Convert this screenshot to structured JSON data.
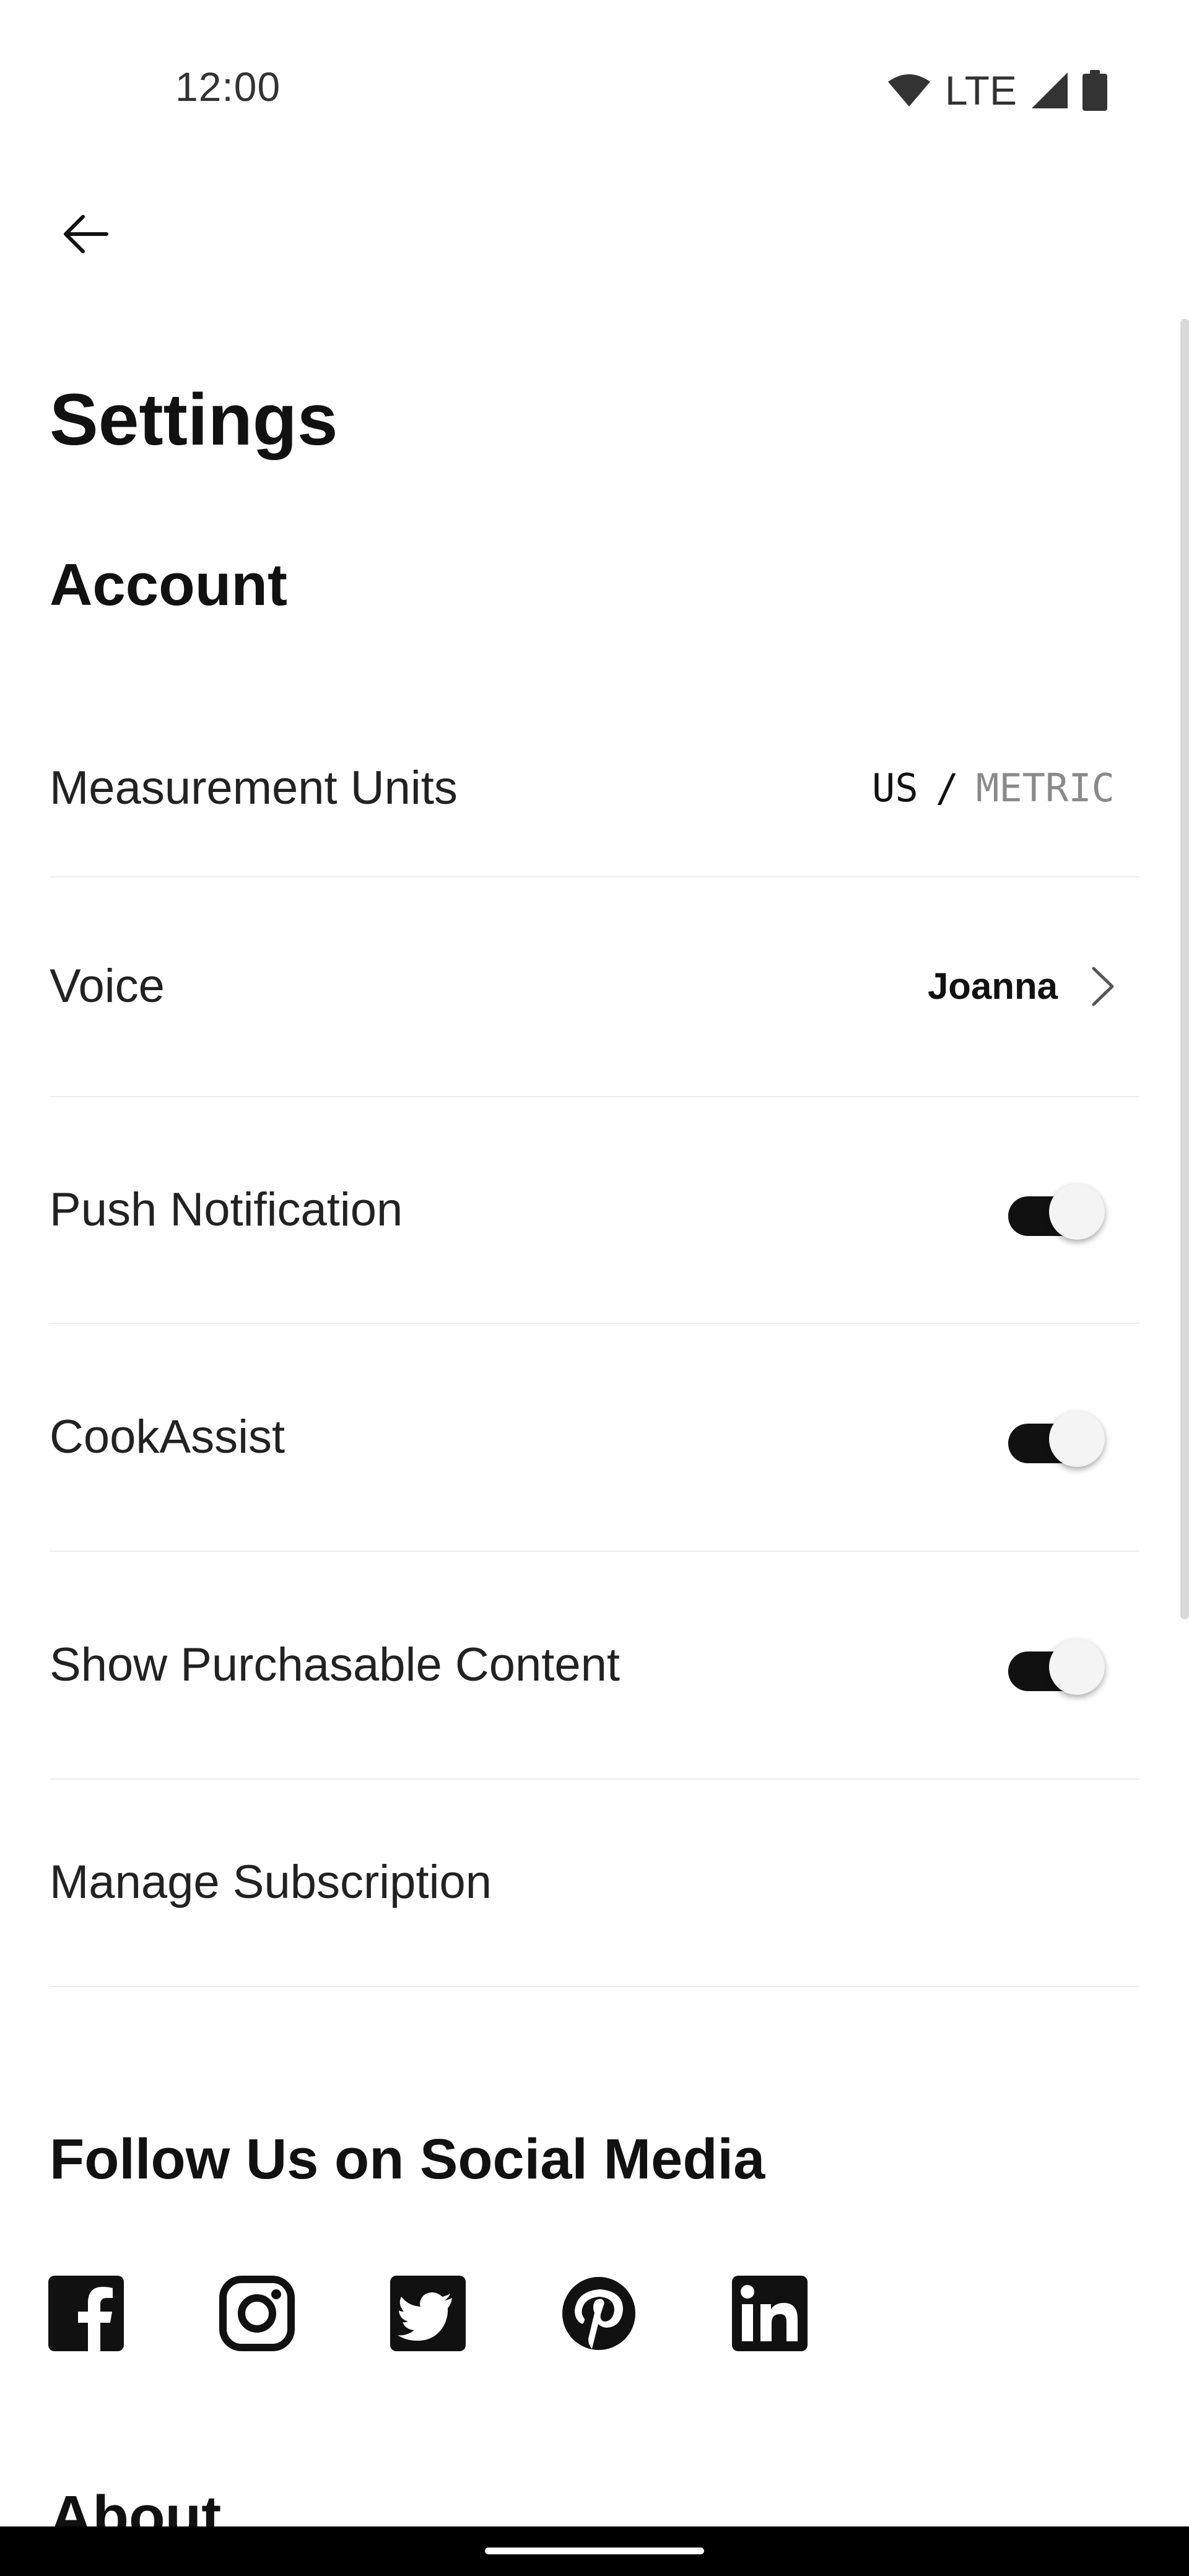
{
  "status_bar": {
    "time": "12:00",
    "network": "LTE",
    "icons": [
      "wifi-icon",
      "cell-signal-icon",
      "battery-icon"
    ]
  },
  "header": {
    "back_icon": "arrow-left-icon",
    "title": "Settings"
  },
  "account": {
    "title": "Account",
    "measurement_units": {
      "label": "Measurement Units",
      "options": [
        "US",
        "METRIC"
      ],
      "separator": "/",
      "selected": "US"
    },
    "voice": {
      "label": "Voice",
      "value": "Joanna",
      "icon": "chevron-right-icon"
    },
    "push_notification": {
      "label": "Push Notification",
      "enabled": true
    },
    "cook_assist": {
      "label": "CookAssist",
      "enabled": true
    },
    "show_purchasable": {
      "label": "Show Purchasable Content",
      "enabled": true
    },
    "manage_subscription": {
      "label": "Manage Subscription"
    }
  },
  "social": {
    "title": "Follow Us on Social Media",
    "icons": [
      "facebook-icon",
      "instagram-icon",
      "twitter-icon",
      "pinterest-icon",
      "linkedin-icon"
    ]
  },
  "about": {
    "title": "About"
  },
  "colors": {
    "toggle_on": "#111111",
    "divider": "#eeeeee",
    "inactive_unit": "#8a8a8a"
  }
}
